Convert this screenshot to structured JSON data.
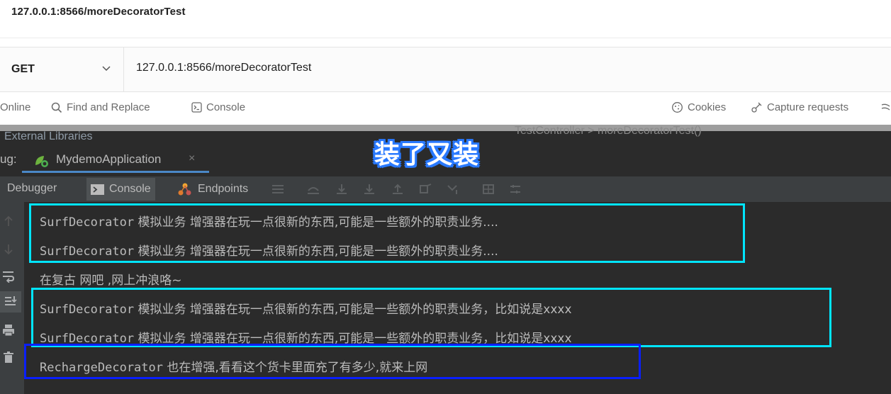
{
  "top": {
    "url_title": "127.0.0.1:8566/moreDecoratorTest",
    "method": "GET",
    "url_value": "127.0.0.1:8566/moreDecoratorTest",
    "footer": {
      "online": "Online",
      "find_replace": "Find and Replace",
      "console": "Console",
      "cookies": "Cookies",
      "capture": "Capture requests"
    }
  },
  "overlay_title": "装了又装",
  "ide": {
    "external_libraries": "External Libraries",
    "breadcrumbs": "TestController  >  moreDecoratorTest()",
    "run_label": "ug:",
    "run_tab": "MydemoApplication",
    "run_tab_close": "×",
    "toolbar": {
      "debugger": "Debugger",
      "console": "Console",
      "endpoints": "Endpoints"
    }
  },
  "console": {
    "lines": [
      {
        "cls": "SurfDecorator",
        "msg": " 模拟业务 增强器在玩一点很新的东西,可能是一些额外的职责业务...."
      },
      {
        "cls": "SurfDecorator",
        "msg": " 模拟业务 增强器在玩一点很新的东西,可能是一些额外的职责业务...."
      },
      {
        "cls": "",
        "msg": "在复古 网吧 ,网上冲浪咯~"
      },
      {
        "cls": "SurfDecorator",
        "msg": " 模拟业务 增强器在玩一点很新的东西,可能是一些额外的职责业务，比如说是xxxx"
      },
      {
        "cls": "SurfDecorator",
        "msg": " 模拟业务 增强器在玩一点很新的东西,可能是一些额外的职责业务，比如说是xxxx"
      },
      {
        "cls": "RechargeDecorator",
        "msg": " 也在增强,看看这个货卡里面充了有多少,就来上网"
      }
    ]
  },
  "colors": {
    "highlight_cyan": "#00e5ff",
    "highlight_blue": "#0a1fff",
    "accent_tab": "#4a88c7"
  },
  "icons": {
    "find": "search-icon",
    "console": "terminal-icon",
    "cookies": "cookie-icon",
    "capture": "capture-icon",
    "run_tab": "spring-boot-icon",
    "endpoints": "endpoints-icon"
  }
}
